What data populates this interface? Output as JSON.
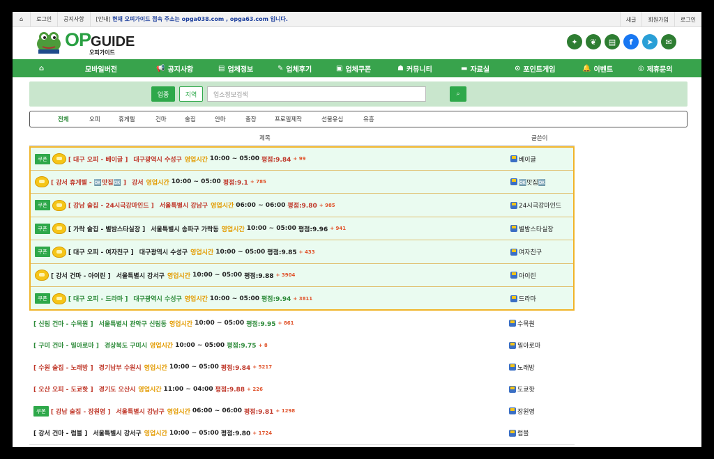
{
  "topbar": {
    "login": "로그인",
    "notice": "공지사항",
    "notice_prefix": "[안내]",
    "notice_text": "현재 오피가이드 접속 주소는 opga038.com , opga63.com 입니다.",
    "search": "새글",
    "join": "회원가입",
    "login_right": "로그인"
  },
  "logo": {
    "op": "OP",
    "guide": "GUIDE",
    "sub": "오피가이드"
  },
  "social_icons": [
    "party-icon",
    "bird-icon",
    "document-icon",
    "facebook-icon",
    "telegram-icon",
    "mail-icon"
  ],
  "nav": [
    {
      "icon": "home-icon",
      "label": ""
    },
    {
      "label": "모바일버전"
    },
    {
      "icon": "megaphone-icon",
      "label": "공지사항"
    },
    {
      "icon": "list-icon",
      "label": "업체정보"
    },
    {
      "icon": "pencil-icon",
      "label": "업체후기"
    },
    {
      "icon": "bus-icon",
      "label": "업체쿠폰"
    },
    {
      "icon": "users-icon",
      "label": "커뮤니티"
    },
    {
      "icon": "folder-icon",
      "label": "자료실"
    },
    {
      "icon": "gamepad-icon",
      "label": "포인트게임"
    },
    {
      "icon": "bell-icon",
      "label": "이벤트"
    },
    {
      "icon": "handshake-icon",
      "label": "제휴문의"
    }
  ],
  "search": {
    "tab_business": "업종",
    "tab_region": "지역",
    "placeholder": "업소정보검색"
  },
  "categories": [
    "전체",
    "오피",
    "휴게텔",
    "건마",
    "술집",
    "안마",
    "출장",
    "프로필제작",
    "선불유심",
    "유흥"
  ],
  "table_header": {
    "title": "제목",
    "author": "글쓴이"
  },
  "hours_label": "영업시간",
  "featured": [
    {
      "coupon": "쿠폰",
      "tag": "[ 대구 오피 - 베이글 ]",
      "addr": "대구광역시 수성구",
      "hours": "10:00 ~ 05:00",
      "score": "평점:9.84",
      "count": "+ 99",
      "author": "베이글",
      "color": "red"
    },
    {
      "coupon": "",
      "tag": "[ 강서 휴게텔 - 🆗맛집🆗 ]",
      "addr": "강서",
      "hours": "10:00 ~ 05:00",
      "score": "평점:9.1",
      "count": "+ 785",
      "author": "🆗맛집🆗",
      "color": "red"
    },
    {
      "coupon": "쿠폰",
      "tag": "[ 강남 술집 - 24시극강마인드 ]",
      "addr": "서울특별시 강남구",
      "hours": "06:00 ~ 06:00",
      "score": "평점:9.80",
      "count": "+ 985",
      "author": "24시극강마인드",
      "color": "red"
    },
    {
      "coupon": "쿠폰",
      "tag": "[ 가락 술집 - 별밤스타실장 ]",
      "addr": "서울특별시 송파구 가락동",
      "hours": "10:00 ~ 05:00",
      "score": "평점:9.96",
      "count": "+ 941",
      "author": "별밤스타실장",
      "color": "dark"
    },
    {
      "coupon": "쿠폰",
      "tag": "[ 대구 오피 - 여자친구 ]",
      "addr": "대구광역시 수성구",
      "hours": "10:00 ~ 05:00",
      "score": "평점:9.85",
      "count": "+ 433",
      "author": "여자친구",
      "color": "dark"
    },
    {
      "coupon": "",
      "tag": "[ 강서 건마 - 아이린 ]",
      "addr": "서울특별시 강서구",
      "hours": "10:00 ~ 05:00",
      "score": "평점:9.88",
      "count": "+ 3904",
      "author": "아이린",
      "color": "dark"
    },
    {
      "coupon": "쿠폰",
      "tag": "[ 대구 오피 - 드라마 ]",
      "addr": "대구광역시 수성구",
      "hours": "10:00 ~ 05:00",
      "score": "평점:9.94",
      "count": "+ 3811",
      "author": "드라마",
      "color": "green"
    }
  ],
  "normal": [
    {
      "coupon": "",
      "tag": "[ 신림 건마 - 수목원 ]",
      "addr": "서울특별시 관악구 신림동",
      "hours": "10:00 ~ 05:00",
      "score": "평점:9.95",
      "count": "+ 861",
      "author": "수목원",
      "color": "green"
    },
    {
      "coupon": "",
      "tag": "[ 구미 건마 - 밀아로마 ]",
      "addr": "경상북도 구미시",
      "hours": "10:00 ~ 05:00",
      "score": "평점:9.75",
      "count": "+ 8",
      "author": "밀아로마",
      "color": "green"
    },
    {
      "coupon": "",
      "tag": "[ 수원 술집 - 노래방 ]",
      "addr": "경기남부 수원시",
      "hours": "10:00 ~ 05:00",
      "score": "평점:9.84",
      "count": "+ 5217",
      "author": "노래방",
      "color": "red"
    },
    {
      "coupon": "",
      "tag": "[ 오산 오피 - 도쿄핫 ]",
      "addr": "경기도 오산시",
      "hours": "11:00 ~ 04:00",
      "score": "평점:9.88",
      "count": "+ 226",
      "author": "도쿄핫",
      "color": "red"
    },
    {
      "coupon": "쿠폰",
      "tag": "[ 강남 술집 - 장원영 ]",
      "addr": "서울특별시 강남구",
      "hours": "06:00 ~ 06:00",
      "score": "평점:9.81",
      "count": "+ 1298",
      "author": "장원영",
      "color": "red"
    },
    {
      "coupon": "",
      "tag": "[ 강서 건마 - 럼블 ]",
      "addr": "서울특별시 강서구",
      "hours": "10:00 ~ 05:00",
      "score": "평점:9.80",
      "count": "+ 1724",
      "author": "럼블",
      "color": "dark"
    }
  ]
}
